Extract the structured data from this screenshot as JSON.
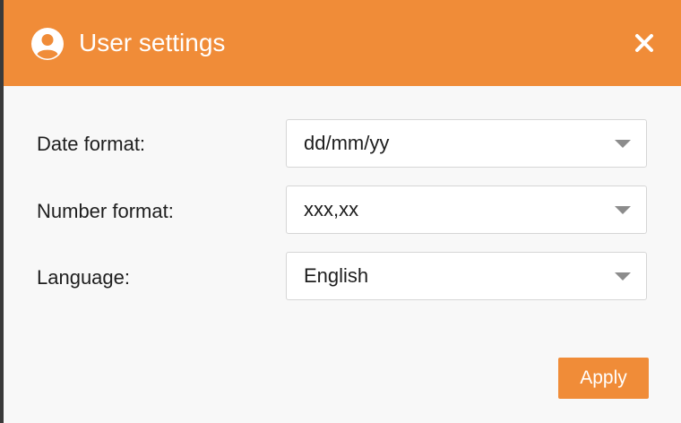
{
  "dialog": {
    "title": "User settings",
    "title_icon": "user-circle-icon",
    "close_icon": "close-icon",
    "header_color": "#f08c38"
  },
  "fields": [
    {
      "label": "Date format:",
      "value": "dd/mm/yy"
    },
    {
      "label": "Number format:",
      "value": "xxx,xx"
    },
    {
      "label": "Language:",
      "value": "English"
    }
  ],
  "footer": {
    "apply_label": "Apply",
    "apply_color": "#f08c38"
  }
}
